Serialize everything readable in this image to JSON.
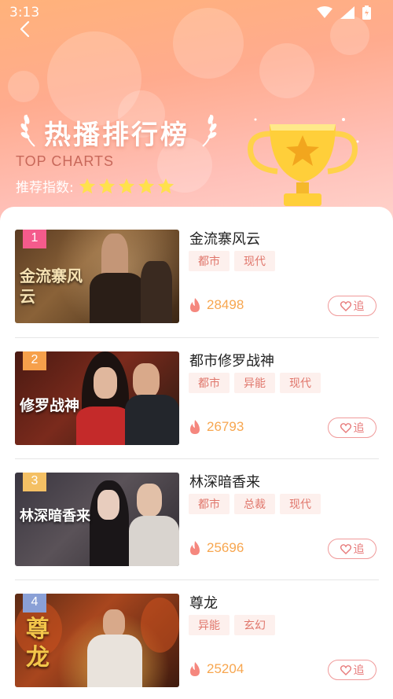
{
  "status_bar": {
    "time": "3:13"
  },
  "header": {
    "title": "热播排行榜",
    "subtitle": "TOP CHARTS",
    "rating_label": "推荐指数:",
    "rating_stars": 5
  },
  "colors": {
    "accent": "#f7a64f",
    "tag_text": "#e0766b",
    "tag_bg": "#fdf0ed",
    "follow_border": "#f09a9a"
  },
  "items": [
    {
      "rank": "1",
      "name": "金流寨风云",
      "tags": [
        "都市",
        "现代"
      ],
      "heat": "28498",
      "follow_label": "追",
      "thumb_caption": "金流寨风云"
    },
    {
      "rank": "2",
      "name": "都市修罗战神",
      "tags": [
        "都市",
        "异能",
        "现代"
      ],
      "heat": "26793",
      "follow_label": "追",
      "thumb_caption": "修罗战神"
    },
    {
      "rank": "3",
      "name": "林深暗香来",
      "tags": [
        "都市",
        "总裁",
        "现代"
      ],
      "heat": "25696",
      "follow_label": "追",
      "thumb_caption": "林深暗香来"
    },
    {
      "rank": "4",
      "name": "尊龙",
      "tags": [
        "异能",
        "玄幻"
      ],
      "heat": "25204",
      "follow_label": "追",
      "thumb_caption": "尊龙"
    }
  ]
}
